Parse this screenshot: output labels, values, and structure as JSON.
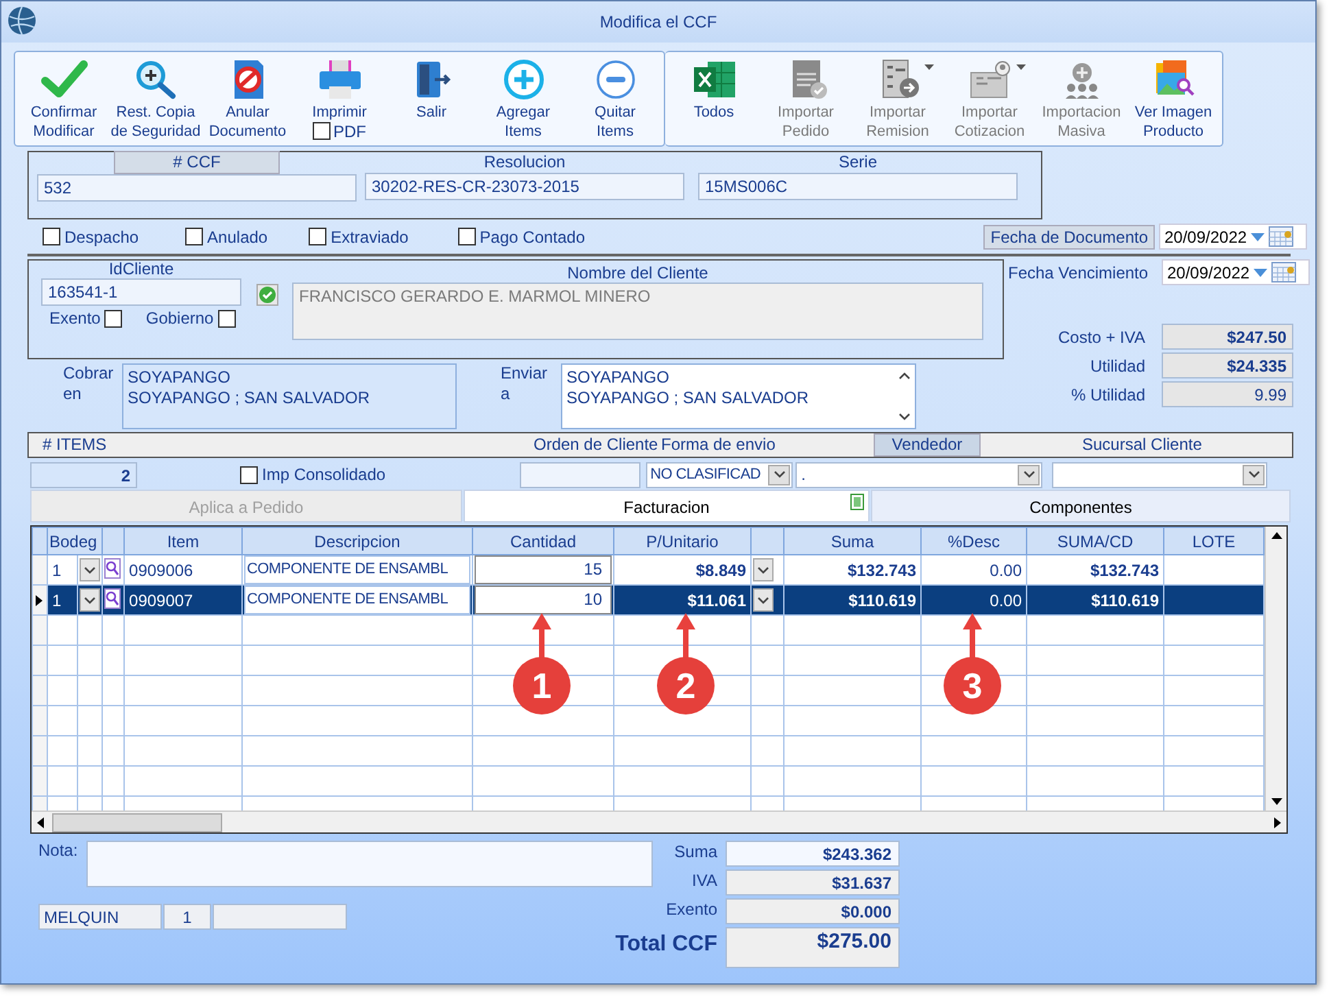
{
  "window": {
    "title": "Modifica el CCF"
  },
  "toolbar": {
    "left": [
      {
        "label": "Confirmar\nModificar"
      },
      {
        "label": "Rest. Copia\nde Seguridad"
      },
      {
        "label": "Anular\nDocumento"
      },
      {
        "label": "Imprimir",
        "pdf": {
          "label": "PDF",
          "checked": false
        }
      },
      {
        "label": "Salir"
      },
      {
        "label": "Agregar\nItems"
      },
      {
        "label": "Quitar\nItems"
      }
    ],
    "right": [
      {
        "label": "Todos",
        "disabled": false,
        "dropdown": false
      },
      {
        "label": "Importar\nPedido",
        "disabled": true,
        "dropdown": false
      },
      {
        "label": "Importar\nRemision",
        "disabled": true,
        "dropdown": true
      },
      {
        "label": "Importar\nCotizacion",
        "disabled": true,
        "dropdown": true
      },
      {
        "label": "Importacion\nMasiva",
        "disabled": true,
        "dropdown": false
      },
      {
        "label": "Ver Imagen\nProducto",
        "disabled": false,
        "dropdown": false
      }
    ]
  },
  "document": {
    "fields": [
      {
        "label": "# CCF",
        "highlighted": true,
        "value": "532"
      },
      {
        "label": "Resolucion",
        "highlighted": false,
        "value": "30202-RES-CR-23073-2015"
      },
      {
        "label": "Serie",
        "highlighted": false,
        "value": "15MS006C"
      }
    ],
    "flags": [
      {
        "label": "Despacho",
        "checked": false
      },
      {
        "label": "Anulado",
        "checked": false
      },
      {
        "label": "Extraviado",
        "checked": false
      },
      {
        "label": "Pago Contado",
        "checked": false
      }
    ],
    "fecha_documento": {
      "label": "Fecha de  Documento",
      "value": "20/09/2022"
    },
    "fecha_vencimiento": {
      "label": "Fecha Vencimiento",
      "value": "20/09/2022"
    }
  },
  "client": {
    "id_label": "IdCliente",
    "id": "163541-1",
    "exento": {
      "label": "Exento",
      "checked": false
    },
    "gobierno": {
      "label": "Gobierno",
      "checked": false
    },
    "name_label": "Nombre del Cliente",
    "name": "FRANCISCO GERARDO E. MARMOL MINERO"
  },
  "costs": [
    {
      "label": "Costo + IVA",
      "value": "$247.50",
      "bold": true
    },
    {
      "label": "Utilidad",
      "value": "$24.335",
      "bold": true
    },
    {
      "label": "% Utilidad",
      "value": "9.99",
      "bold": false
    }
  ],
  "addresses": [
    {
      "label": "Cobrar\nen",
      "lines": [
        "SOYAPANGO",
        "SOYAPANGO ; SAN SALVADOR"
      ]
    },
    {
      "label": "Enviar\na",
      "lines": [
        "SOYAPANGO",
        "SOYAPANGO ; SAN SALVADOR"
      ]
    }
  ],
  "items_bar": {
    "headers": [
      {
        "label": "# ITEMS",
        "highlighted": false
      },
      {
        "label": "Orden de Cliente",
        "highlighted": false
      },
      {
        "label": "Forma de envio",
        "highlighted": false
      },
      {
        "label": "Vendedor",
        "highlighted": true
      },
      {
        "label": "Sucursal Cliente",
        "highlighted": false
      }
    ],
    "count": "2",
    "consolidado": {
      "label": "Imp Consolidado",
      "checked": false
    },
    "forma_envio": "NO CLASIFICAD",
    "vendedor": "."
  },
  "tabs": [
    {
      "label": "Aplica a Pedido",
      "selected": false,
      "disabled": true
    },
    {
      "label": "Facturacion",
      "selected": true,
      "disabled": false
    },
    {
      "label": "Componentes",
      "selected": false,
      "disabled": false
    }
  ],
  "table": {
    "columns": [
      "Bodeg",
      "Item",
      "Descripcion",
      "Cantidad",
      "P/Unitario",
      "Suma",
      "%Desc",
      "SUMA/CD",
      "LOTE"
    ],
    "rows": [
      {
        "selected": false,
        "cells": [
          "1",
          "0909006",
          "COMPONENTE DE ENSAMBL",
          "15",
          "$8.849",
          "$132.743",
          "0.00",
          "$132.743"
        ]
      },
      {
        "selected": true,
        "cells": [
          "1",
          "0909007",
          "COMPONENTE DE ENSAMBL",
          "10",
          "$11.061",
          "$110.619",
          "0.00",
          "$110.619"
        ]
      }
    ]
  },
  "callouts": [
    "1",
    "2",
    "3"
  ],
  "note": {
    "label": "Nota:"
  },
  "status": {
    "user": "MELQUIN",
    "number": "1"
  },
  "totals": [
    {
      "label": "Suma",
      "value": "$243.362",
      "kind": "line"
    },
    {
      "label": "IVA",
      "value": "$31.637",
      "kind": "line"
    },
    {
      "label": "Exento",
      "value": "$0.000",
      "kind": "line"
    },
    {
      "label": "Total CCF",
      "value": "$275.00",
      "kind": "total"
    }
  ]
}
